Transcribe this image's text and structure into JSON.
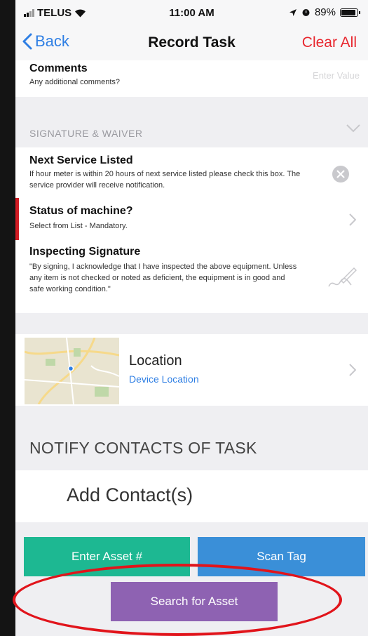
{
  "status_bar": {
    "carrier": "TELUS",
    "time": "11:00 AM",
    "battery_percent": "89%",
    "battery_level": 0.89
  },
  "nav": {
    "back_label": "Back",
    "title": "Record Task",
    "clear_label": "Clear All"
  },
  "comments": {
    "title": "Comments",
    "subtitle": "Any additional comments?",
    "placeholder": "Enter Value"
  },
  "section": {
    "label": "SIGNATURE & WAIVER"
  },
  "fields": [
    {
      "title": "Next Service Listed",
      "subtitle": "If hour meter is within 20 hours of next service listed please check this box. The service provider will receive notification."
    },
    {
      "title": "Status of machine?",
      "subtitle": "Select from List - Mandatory."
    },
    {
      "title": "Inspecting Signature",
      "subtitle": "\"By signing, I acknowledge that I have inspected the above equipment. Unless any item is not checked or noted as deficient, the equipment is in good and safe working condition.\""
    }
  ],
  "location": {
    "title": "Location",
    "subtitle": "Device Location"
  },
  "notify": {
    "label": "NOTIFY CONTACTS OF TASK",
    "add_contact": "Add Contact(s)"
  },
  "buttons": {
    "enter_asset": "Enter Asset #",
    "scan_tag": "Scan Tag",
    "search_asset": "Search for Asset"
  },
  "colors": {
    "accent_blue": "#2f7fe4",
    "clear_red": "#e8262e",
    "enter_asset_green": "#1db892",
    "scan_tag_blue": "#3a8fd8",
    "search_purple": "#8e62b2",
    "mandatory_red": "#d11c24",
    "highlight_red": "#e1141b"
  }
}
